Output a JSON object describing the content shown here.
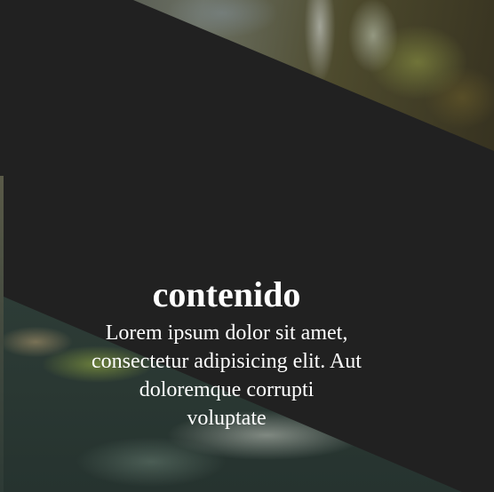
{
  "section": {
    "heading": "contenido",
    "paragraph_lines": [
      "Lorem ipsum dolor sit amet,",
      "consectetur adipisicing elit. Aut",
      "doloremque corrupti",
      "voluptate"
    ]
  },
  "images": {
    "top": "waterfall-photo",
    "bottom": "river-photo"
  },
  "colors": {
    "background": "#212121",
    "text": "#ffffff"
  }
}
